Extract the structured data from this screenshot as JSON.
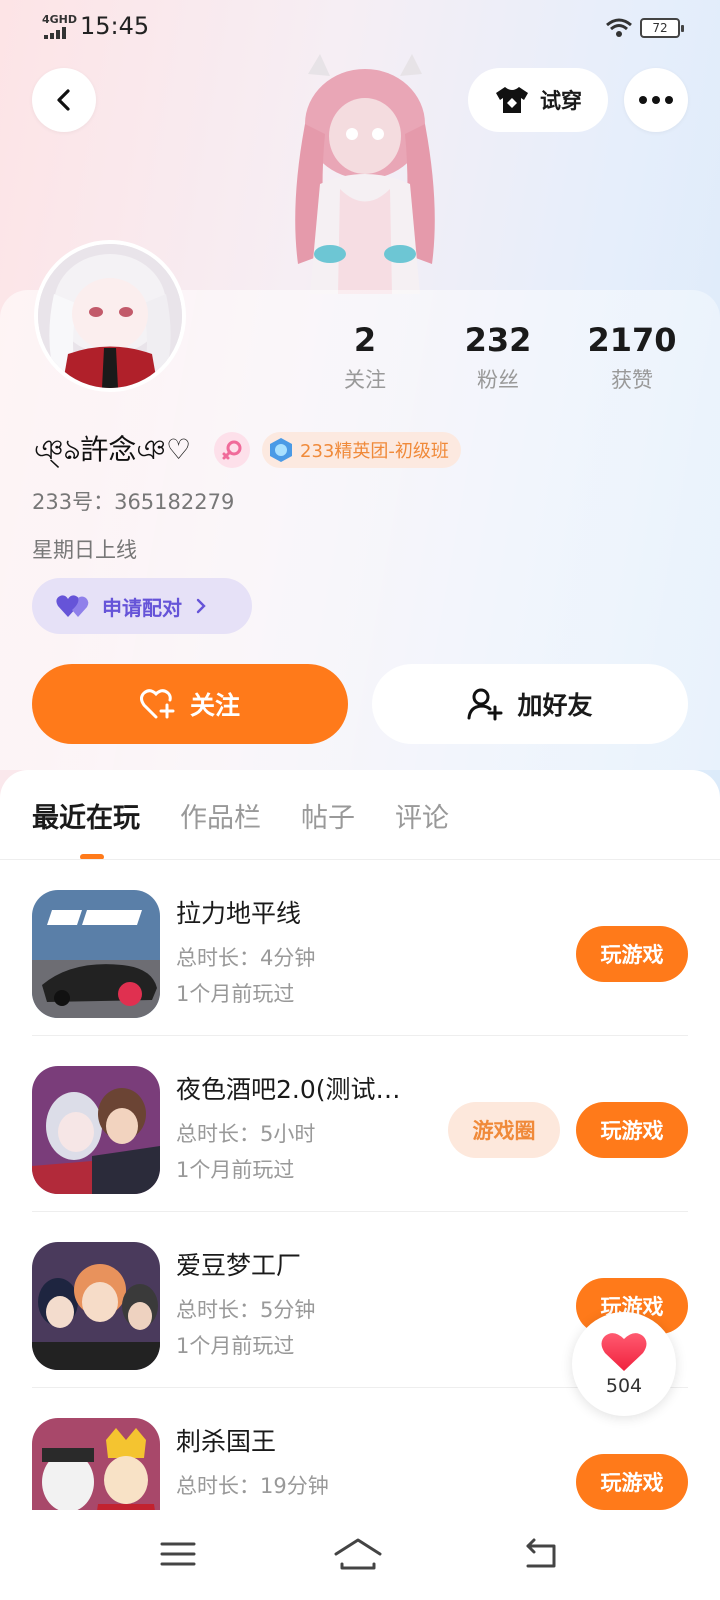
{
  "status_bar": {
    "network": "4GHD",
    "time": "15:45",
    "battery": "72"
  },
  "header": {
    "try_on_label": "试穿"
  },
  "profile": {
    "name": "ঞ্ঌ許念ঞ♡",
    "badge": "233精英团-初级班",
    "id_label": "233号：365182279",
    "last_online": "星期日上线",
    "pair_label": "申请配对",
    "stats": [
      {
        "value": "2",
        "label": "关注"
      },
      {
        "value": "232",
        "label": "粉丝"
      },
      {
        "value": "2170",
        "label": "获赞"
      }
    ],
    "follow_label": "关注",
    "add_friend_label": "加好友"
  },
  "tabs": [
    "最近在玩",
    "作品栏",
    "帖子",
    "评论"
  ],
  "games": [
    {
      "title": "拉力地平线",
      "duration": "总时长：4分钟",
      "last_played": "1个月前玩过",
      "play_label": "玩游戏"
    },
    {
      "title": "夜色酒吧2.0(测试…",
      "duration": "总时长：5小时",
      "last_played": "1个月前玩过",
      "circle_label": "游戏圈",
      "play_label": "玩游戏"
    },
    {
      "title": "爱豆梦工厂",
      "duration": "总时长：5分钟",
      "last_played": "1个月前玩过",
      "play_label": "玩游戏"
    },
    {
      "title": "刺杀国王",
      "duration": "总时长：19分钟",
      "last_played": "",
      "play_label": "玩游戏"
    }
  ],
  "likes": {
    "count": "504"
  },
  "colors": {
    "accent": "#ff7a1a",
    "pair": "#6654d8",
    "badge_text": "#f08a3a"
  }
}
